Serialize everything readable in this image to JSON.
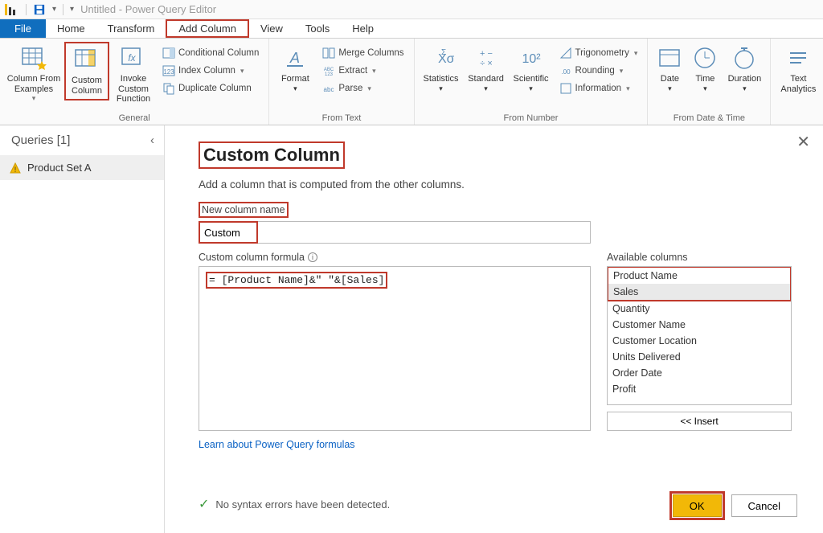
{
  "window_title": "Untitled - Power Query Editor",
  "tabs": {
    "file": "File",
    "home": "Home",
    "transform": "Transform",
    "addcol": "Add Column",
    "view": "View",
    "tools": "Tools",
    "help": "Help"
  },
  "ribbon": {
    "general": {
      "col_from_examples": "Column From Examples",
      "custom_column": "Custom Column",
      "invoke_custom_fn": "Invoke Custom Function",
      "conditional": "Conditional Column",
      "index": "Index Column",
      "duplicate": "Duplicate Column",
      "label": "General"
    },
    "fromtext": {
      "format": "Format",
      "merge": "Merge Columns",
      "extract": "Extract",
      "parse": "Parse",
      "label": "From Text"
    },
    "fromnumber": {
      "stats": "Statistics",
      "standard": "Standard",
      "scientific": "Scientific",
      "ten": "10",
      "trig": "Trigonometry",
      "round": "Rounding",
      "info": "Information",
      "label": "From Number"
    },
    "fromdate": {
      "date": "Date",
      "time": "Time",
      "duration": "Duration",
      "label": "From Date & Time"
    },
    "analytics": {
      "text": "Text Analytics"
    }
  },
  "queries": {
    "header": "Queries [1]",
    "items": [
      "Product Set A"
    ]
  },
  "dialog": {
    "title": "Custom Column",
    "sub": "Add a column that is computed from the other columns.",
    "new_col_label": "New column name",
    "new_col_value": "Custom",
    "formula_label": "Custom column formula",
    "formula_value": "= [Product Name]&\" \"&[Sales]",
    "avail_label": "Available columns",
    "avail_cols": [
      "Product Name",
      "Sales",
      "Quantity",
      "Customer Name",
      "Customer Location",
      "Units Delivered",
      "Order Date",
      "Profit"
    ],
    "insert": "<< Insert",
    "learn": "Learn about Power Query formulas",
    "status": "No syntax errors have been detected.",
    "ok": "OK",
    "cancel": "Cancel"
  }
}
